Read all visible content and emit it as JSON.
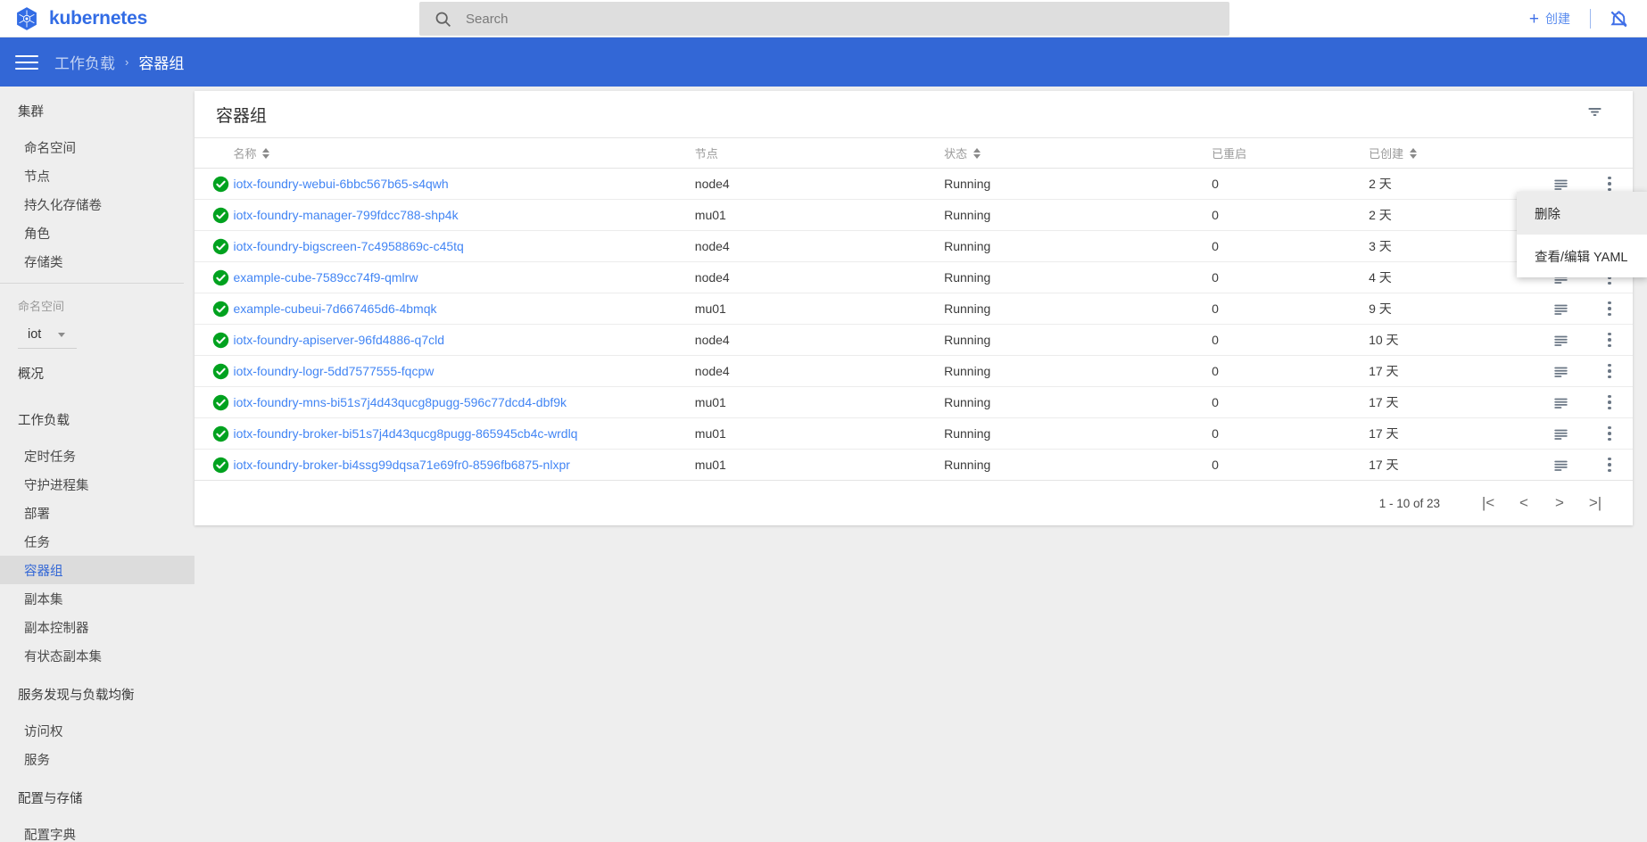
{
  "topbar": {
    "brand": "kubernetes",
    "logo_icon": "kubernetes-helm-logo-icon",
    "search": {
      "icon": "search-icon",
      "placeholder": "Search",
      "value": ""
    },
    "create_label": "创建",
    "create_icon": "plus-icon",
    "notifications_icon": "notifications-off-icon"
  },
  "breadcrumb": {
    "menu_icon": "hamburger-menu-icon",
    "parent": "工作负载",
    "separator": "›",
    "current": "容器组"
  },
  "sidebar": {
    "cluster_section": {
      "title": "集群",
      "items": [
        {
          "label": "命名空间"
        },
        {
          "label": "节点"
        },
        {
          "label": "持久化存储卷"
        },
        {
          "label": "角色"
        },
        {
          "label": "存储类"
        }
      ]
    },
    "namespace": {
      "label": "命名空间",
      "value": "iot",
      "caret_icon": "chevron-down-icon"
    },
    "overview": {
      "label": "概况"
    },
    "workloads_section": {
      "title": "工作负载",
      "items": [
        {
          "label": "定时任务",
          "selected": false
        },
        {
          "label": "守护进程集",
          "selected": false
        },
        {
          "label": "部署",
          "selected": false
        },
        {
          "label": "任务",
          "selected": false
        },
        {
          "label": "容器组",
          "selected": true
        },
        {
          "label": "副本集",
          "selected": false
        },
        {
          "label": "副本控制器",
          "selected": false
        },
        {
          "label": "有状态副本集",
          "selected": false
        }
      ]
    },
    "discovery_section": {
      "title": "服务发现与负载均衡",
      "items": [
        {
          "label": "访问权"
        },
        {
          "label": "服务"
        }
      ]
    },
    "config_section": {
      "title": "配置与存储",
      "items": [
        {
          "label": "配置字典"
        }
      ]
    }
  },
  "card": {
    "title": "容器组",
    "filter_icon": "filter-icon",
    "columns": [
      {
        "key": "status",
        "label": ""
      },
      {
        "key": "name",
        "label": "名称",
        "sortable": true
      },
      {
        "key": "node",
        "label": "节点",
        "sortable": false
      },
      {
        "key": "state",
        "label": "状态",
        "sortable": true
      },
      {
        "key": "restart",
        "label": "已重启",
        "sortable": false
      },
      {
        "key": "created",
        "label": "已创建",
        "sortable": true
      }
    ],
    "row_action_icons": {
      "logs": "logs-icon",
      "menu": "more-vertical-icon"
    },
    "rows": [
      {
        "status": "healthy",
        "name": "iotx-foundry-webui-6bbc567b65-s4qwh",
        "node": "node4",
        "state": "Running",
        "restart": "0",
        "created": "2 天"
      },
      {
        "status": "healthy",
        "name": "iotx-foundry-manager-799fdcc788-shp4k",
        "node": "mu01",
        "state": "Running",
        "restart": "0",
        "created": "2 天"
      },
      {
        "status": "healthy",
        "name": "iotx-foundry-bigscreen-7c4958869c-c45tq",
        "node": "node4",
        "state": "Running",
        "restart": "0",
        "created": "3 天"
      },
      {
        "status": "healthy",
        "name": "example-cube-7589cc74f9-qmlrw",
        "node": "node4",
        "state": "Running",
        "restart": "0",
        "created": "4 天"
      },
      {
        "status": "healthy",
        "name": "example-cubeui-7d667465d6-4bmqk",
        "node": "mu01",
        "state": "Running",
        "restart": "0",
        "created": "9 天"
      },
      {
        "status": "healthy",
        "name": "iotx-foundry-apiserver-96fd4886-q7cld",
        "node": "node4",
        "state": "Running",
        "restart": "0",
        "created": "10 天"
      },
      {
        "status": "healthy",
        "name": "iotx-foundry-logr-5dd7577555-fqcpw",
        "node": "node4",
        "state": "Running",
        "restart": "0",
        "created": "17 天"
      },
      {
        "status": "healthy",
        "name": "iotx-foundry-mns-bi51s7j4d43qucg8pugg-596c77dcd4-dbf9k",
        "node": "mu01",
        "state": "Running",
        "restart": "0",
        "created": "17 天"
      },
      {
        "status": "healthy",
        "name": "iotx-foundry-broker-bi51s7j4d43qucg8pugg-865945cb4c-wrdlq",
        "node": "mu01",
        "state": "Running",
        "restart": "0",
        "created": "17 天"
      },
      {
        "status": "healthy",
        "name": "iotx-foundry-broker-bi4ssg99dqsa71e69fr0-8596fb6875-nlxpr",
        "node": "mu01",
        "state": "Running",
        "restart": "0",
        "created": "17 天"
      }
    ],
    "pagination": {
      "label": "1 - 10 of 23",
      "first_icon": "first-page-icon",
      "prev_icon": "chevron-left-icon",
      "next_icon": "chevron-right-icon",
      "last_icon": "last-page-icon"
    }
  },
  "context_menu": {
    "items": [
      {
        "label": "删除",
        "hovered": true
      },
      {
        "label": "查看/编辑 YAML",
        "hovered": false
      }
    ]
  },
  "colors": {
    "brand_blue": "#326ce5",
    "header_blue": "#3367d6",
    "link_blue": "#4285f4",
    "status_green": "#00a21f",
    "sidebar_bg": "#eeeeee",
    "selected_bg": "#dcdcdc"
  }
}
